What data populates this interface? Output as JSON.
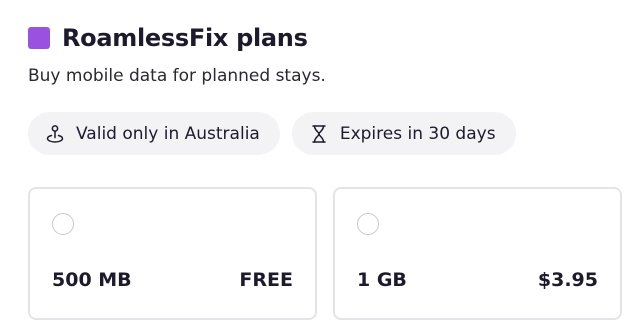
{
  "app": {
    "title": "RoamlessFix plans",
    "subtitle": "Buy mobile data for planned stays.",
    "brand_color": "#9b51e0"
  },
  "chips": [
    {
      "icon": "location-pin-icon",
      "label": "Valid only in Australia"
    },
    {
      "icon": "hourglass-icon",
      "label": "Expires in 30 days"
    }
  ],
  "plans": [
    {
      "size": "500 MB",
      "price": "FREE",
      "selected": false
    },
    {
      "size": "1 GB",
      "price": "$3.95",
      "selected": false
    }
  ]
}
